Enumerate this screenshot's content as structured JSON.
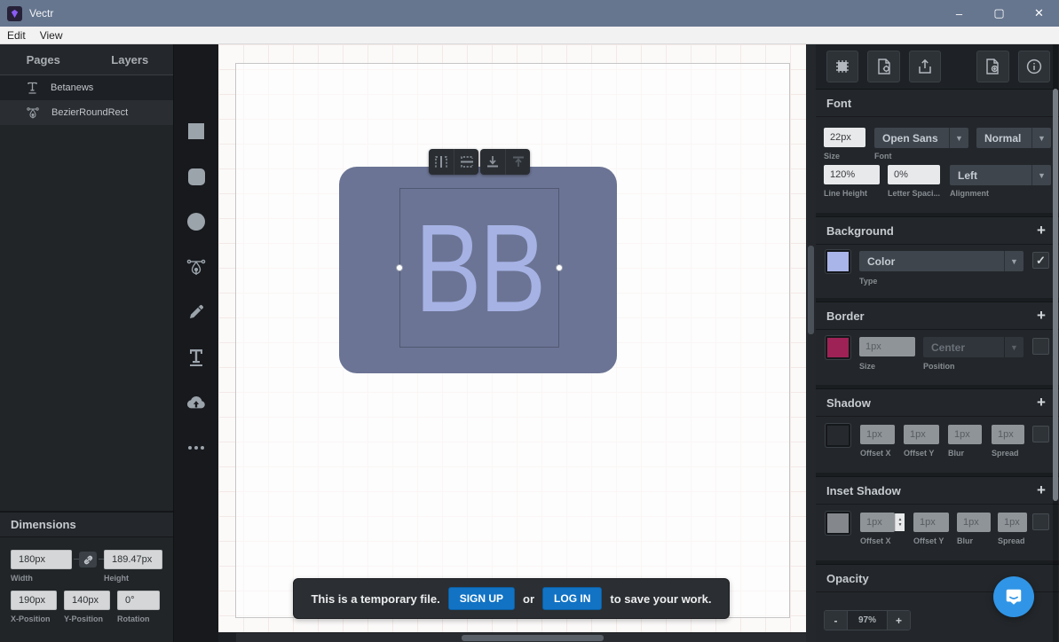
{
  "titlebar": {
    "app_title": "Vectr",
    "minimize": "–",
    "maximize": "▢",
    "close": "✕"
  },
  "menubar": {
    "items": [
      {
        "label": "Edit"
      },
      {
        "label": "View"
      }
    ]
  },
  "left_panel": {
    "tabs": [
      {
        "label": "Pages"
      },
      {
        "label": "Layers"
      }
    ],
    "layers": [
      {
        "label": "Betanews",
        "icon": "text-layer-icon"
      },
      {
        "label": "BezierRoundRect",
        "icon": "bezier-layer-icon"
      }
    ],
    "dimensions": {
      "title": "Dimensions",
      "width": {
        "value": "180px",
        "label": "Width"
      },
      "height": {
        "value": "189.47px",
        "label": "Height"
      },
      "x": {
        "value": "190px",
        "label": "X-Position"
      },
      "y": {
        "value": "140px",
        "label": "Y-Position"
      },
      "rotation": {
        "value": "0°",
        "label": "Rotation"
      }
    }
  },
  "toolbar_icons": [
    "rectangle-tool-icon",
    "rounded-rectangle-tool-icon",
    "ellipse-tool-icon",
    "bezier-pen-tool-icon",
    "pencil-tool-icon",
    "text-tool-icon",
    "cloud-upload-icon",
    "more-tools-icon"
  ],
  "canvas": {
    "shape_text": "BB",
    "shape_fill": "#6b7494",
    "text_color": "#a6b2e4",
    "selection_toolbar_icons": [
      "align-horizontal-center-icon",
      "align-vertical-center-icon",
      "send-to-back-icon",
      "bring-to-front-icon"
    ],
    "banner": {
      "prefix": "This is a temporary file.",
      "signup_label": "SIGN UP",
      "or": "or",
      "login_label": "LOG IN",
      "suffix": "to save your work."
    }
  },
  "right_panel": {
    "header_icons": [
      "snap-grid-icon",
      "page-settings-icon",
      "export-icon",
      "add-page-icon",
      "info-icon"
    ],
    "font": {
      "title": "Font",
      "size": {
        "value": "22px",
        "label": "Size"
      },
      "family": {
        "value": "Open Sans",
        "label": "Font"
      },
      "weight": {
        "value": "Normal"
      },
      "line_height": {
        "value": "120%",
        "label": "Line Height"
      },
      "letter_spacing": {
        "value": "0%",
        "label": "Letter Spaci..."
      },
      "alignment": {
        "value": "Left",
        "label": "Alignment"
      }
    },
    "background": {
      "title": "Background",
      "swatch": "#a9b4e8",
      "type": {
        "value": "Color",
        "label": "Type"
      },
      "enabled": true
    },
    "border": {
      "title": "Border",
      "swatch": "#9e2255",
      "size": {
        "value": "1px",
        "label": "Size"
      },
      "position": {
        "value": "Center",
        "label": "Position"
      },
      "enabled": false
    },
    "shadow": {
      "title": "Shadow",
      "swatch": "#26292d",
      "fields": [
        {
          "value": "1px",
          "label": "Offset X"
        },
        {
          "value": "1px",
          "label": "Offset Y"
        },
        {
          "value": "1px",
          "label": "Blur"
        },
        {
          "value": "1px",
          "label": "Spread"
        }
      ],
      "enabled": false
    },
    "inset_shadow": {
      "title": "Inset Shadow",
      "swatch": "#84888d",
      "fields": [
        {
          "value": "1px",
          "label": "Offset X"
        },
        {
          "value": "1px",
          "label": "Offset Y"
        },
        {
          "value": "1px",
          "label": "Blur"
        },
        {
          "value": "1px",
          "label": "Spread"
        }
      ],
      "enabled": false
    },
    "opacity": {
      "title": "Opacity",
      "minus": "-",
      "value": "97%",
      "plus": "+"
    }
  },
  "colors": {
    "titlebar": "#66768f",
    "accent_blue": "#1273c4",
    "panel_dark": "#23272b",
    "intercom_blue": "#3095e6"
  }
}
